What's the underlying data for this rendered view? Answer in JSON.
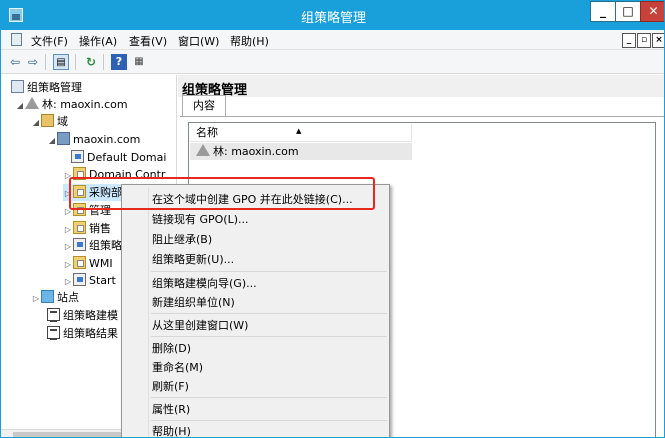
{
  "window": {
    "title": "组策略管理"
  },
  "menubar": {
    "items": [
      {
        "label": "文件(F)"
      },
      {
        "label": "操作(A)"
      },
      {
        "label": "查看(V)"
      },
      {
        "label": "窗口(W)"
      },
      {
        "label": "帮助(H)"
      }
    ]
  },
  "toolbar": {
    "back_icon": "back-arrow-icon",
    "forward_icon": "forward-arrow-icon",
    "view_icon": "console-tree-icon",
    "refresh_icon": "refresh-icon",
    "help_icon": "help-icon",
    "pane_icon": "show-pane-icon"
  },
  "tree": {
    "root": "组策略管理",
    "forest": "林: maoxin.com",
    "domains": "域",
    "domain": "maoxin.com",
    "items": [
      {
        "label": "Default Domai"
      },
      {
        "label": "Domain Contr"
      },
      {
        "label": "采购部"
      },
      {
        "label": "管理"
      },
      {
        "label": "销售"
      },
      {
        "label": "组策略"
      },
      {
        "label": "WMI"
      },
      {
        "label": "Start"
      }
    ],
    "sites": "站点",
    "modeling": "组策略建模",
    "results": "组策略结果"
  },
  "right": {
    "title": "组策略管理",
    "tab": "内容",
    "column": "名称",
    "row": "林: maoxin.com"
  },
  "context_menu": {
    "items": [
      {
        "label": "在这个域中创建 GPO 并在此处链接(C)..."
      },
      {
        "label": "链接现有 GPO(L)..."
      },
      {
        "label": "阻止继承(B)"
      },
      {
        "label": "组策略更新(U)..."
      },
      {
        "label": "组策略建模向导(G)..."
      },
      {
        "label": "新建组织单位(N)"
      },
      {
        "label": "从这里创建窗口(W)"
      },
      {
        "label": "删除(D)"
      },
      {
        "label": "重命名(M)"
      },
      {
        "label": "刷新(F)"
      },
      {
        "label": "属性(R)"
      },
      {
        "label": "帮助(H)"
      }
    ]
  },
  "colors": {
    "titlebar": "#19a0da",
    "highlight_box": "#e8281c"
  }
}
